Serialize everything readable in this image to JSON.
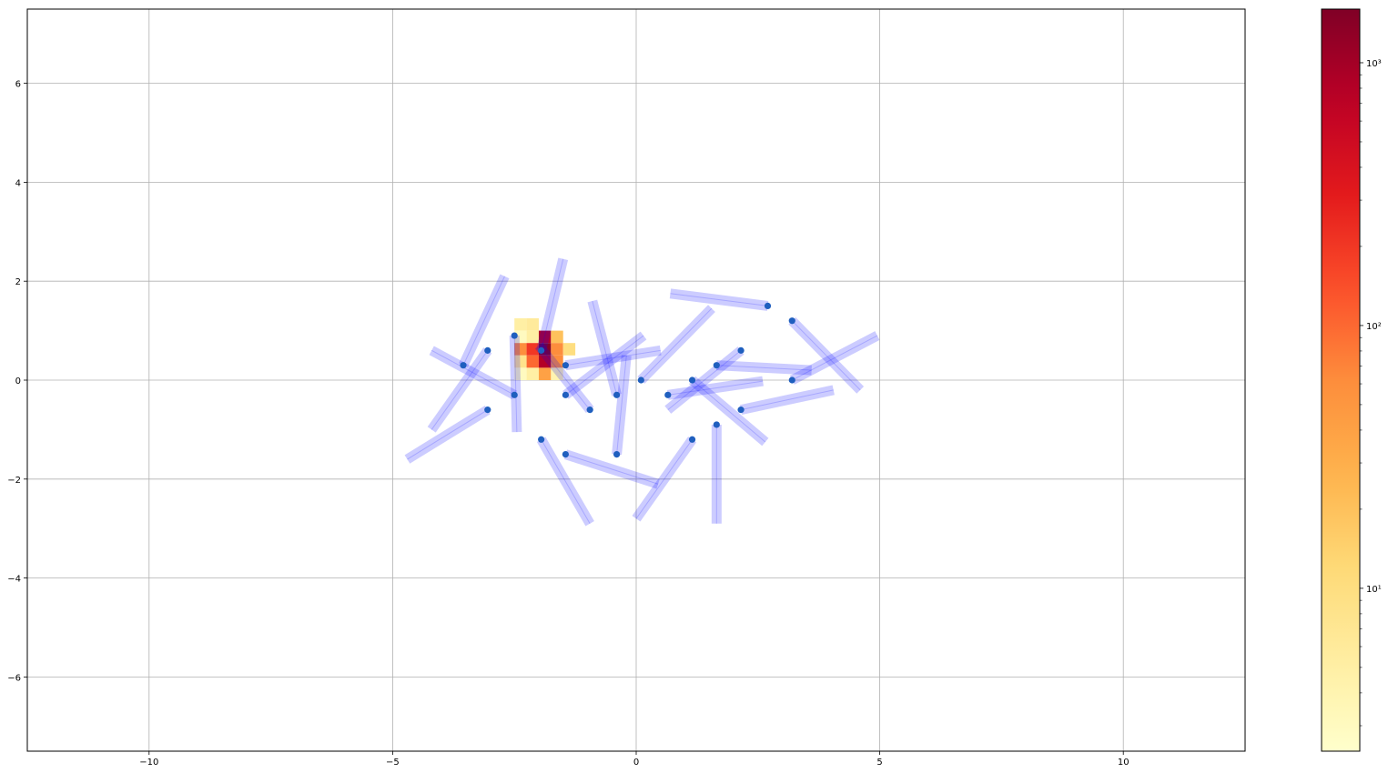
{
  "chart_data": {
    "type": "scatter",
    "title": "",
    "xlabel": "",
    "ylabel": "",
    "xlim": [
      -12.5,
      12.5
    ],
    "ylim": [
      -7.5,
      7.5
    ],
    "grid": true,
    "xticks": [
      -10,
      -5,
      0,
      5,
      10
    ],
    "yticks": [
      -6,
      -4,
      -2,
      0,
      2,
      4,
      6
    ],
    "xtick_labels": [
      "−10",
      "−5",
      "0",
      "5",
      "10"
    ],
    "ytick_labels": [
      "−6",
      "−4",
      "−2",
      "0",
      "2",
      "4",
      "6"
    ],
    "points": [
      [
        -3.55,
        0.3
      ],
      [
        -3.05,
        0.6
      ],
      [
        -2.5,
        0.9
      ],
      [
        -2.5,
        -0.3
      ],
      [
        -3.05,
        -0.6
      ],
      [
        -1.95,
        0.6
      ],
      [
        -1.45,
        0.3
      ],
      [
        -1.45,
        -0.3
      ],
      [
        -0.95,
        -0.6
      ],
      [
        -0.4,
        -0.3
      ],
      [
        -1.95,
        -1.2
      ],
      [
        -1.45,
        -1.5
      ],
      [
        -0.4,
        -1.5
      ],
      [
        0.1,
        0.0
      ],
      [
        0.65,
        -0.3
      ],
      [
        1.15,
        0.0
      ],
      [
        1.65,
        0.3
      ],
      [
        2.15,
        0.6
      ],
      [
        2.15,
        -0.6
      ],
      [
        1.65,
        -0.9
      ],
      [
        1.15,
        -1.2
      ],
      [
        2.7,
        1.5
      ],
      [
        3.2,
        1.2
      ],
      [
        3.2,
        0.0
      ]
    ],
    "segments": [
      [
        -3.55,
        0.3,
        -2.7,
        2.1
      ],
      [
        -3.05,
        0.6,
        -4.2,
        -1.0
      ],
      [
        -2.5,
        0.9,
        -2.45,
        -1.05
      ],
      [
        -2.5,
        -0.3,
        -4.2,
        0.6
      ],
      [
        -3.05,
        -0.6,
        -4.7,
        -1.6
      ],
      [
        -1.95,
        0.6,
        -1.5,
        2.45
      ],
      [
        -1.45,
        0.3,
        0.5,
        0.6
      ],
      [
        -1.45,
        -0.3,
        0.15,
        0.9
      ],
      [
        -0.95,
        -0.6,
        -2.0,
        0.7
      ],
      [
        -0.4,
        -0.3,
        -0.9,
        1.6
      ],
      [
        -0.4,
        -1.5,
        -0.2,
        0.5
      ],
      [
        -1.95,
        -1.2,
        -0.95,
        -2.9
      ],
      [
        -1.45,
        -1.5,
        0.45,
        -2.1
      ],
      [
        0.1,
        0.0,
        1.55,
        1.45
      ],
      [
        0.65,
        -0.3,
        2.6,
        -0.02
      ],
      [
        1.15,
        0.0,
        2.65,
        -1.25
      ],
      [
        1.65,
        0.3,
        3.6,
        0.2
      ],
      [
        2.15,
        0.6,
        0.65,
        -0.6
      ],
      [
        2.15,
        -0.6,
        4.05,
        -0.2
      ],
      [
        1.65,
        -0.9,
        1.65,
        -2.9
      ],
      [
        1.15,
        -1.2,
        0.0,
        -2.8
      ],
      [
        2.7,
        1.5,
        0.7,
        1.75
      ],
      [
        3.2,
        1.2,
        4.6,
        -0.2
      ],
      [
        3.2,
        0.0,
        4.95,
        0.9
      ]
    ],
    "heatmap": {
      "cell_size": 0.25,
      "cells": [
        [
          -2.5,
          1.0,
          5
        ],
        [
          -2.25,
          1.0,
          6
        ],
        [
          -2.5,
          0.75,
          3
        ],
        [
          -2.25,
          0.75,
          5
        ],
        [
          -2.0,
          0.75,
          800
        ],
        [
          -1.75,
          0.75,
          20
        ],
        [
          -2.5,
          0.5,
          60
        ],
        [
          -2.25,
          0.5,
          200
        ],
        [
          -2.0,
          0.5,
          1500
        ],
        [
          -1.75,
          0.5,
          60
        ],
        [
          -1.5,
          0.5,
          10
        ],
        [
          -2.5,
          0.25,
          8
        ],
        [
          -2.25,
          0.25,
          100
        ],
        [
          -2.0,
          0.25,
          800
        ],
        [
          -1.75,
          0.25,
          60
        ],
        [
          -2.5,
          0.0,
          3
        ],
        [
          -2.25,
          0.0,
          5
        ],
        [
          -2.0,
          0.0,
          40
        ],
        [
          -1.75,
          0.0,
          4
        ]
      ]
    },
    "colorbar": {
      "scale": "log",
      "vmin": 2.4,
      "vmax": 1600,
      "colormap": "YlOrRd",
      "ticks": [
        10,
        100,
        1000
      ],
      "tick_labels": [
        "10¹",
        "10²",
        "10³"
      ]
    },
    "colors": {
      "points": "#1f5fbf",
      "segments": "#0000ff",
      "grid": "#b0b0b0"
    }
  }
}
